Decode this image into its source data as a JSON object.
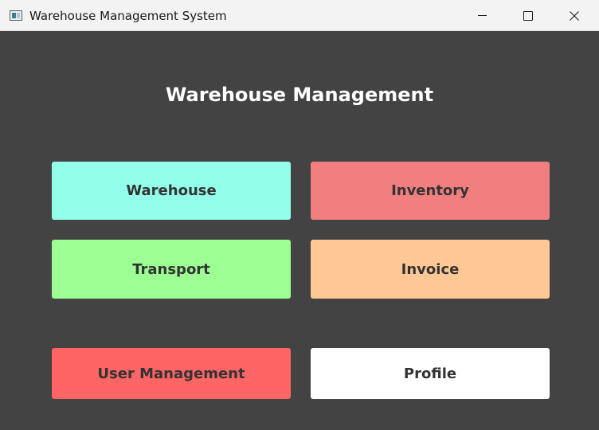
{
  "window": {
    "title": "Warehouse Management System",
    "icon": "app-window-icon",
    "controls": {
      "minimize_icon": "minimize-icon",
      "maximize_icon": "maximize-icon",
      "close_icon": "close-icon"
    }
  },
  "main": {
    "heading": "Warehouse Management",
    "buttons": [
      {
        "label": "Warehouse",
        "color": "#93ffea"
      },
      {
        "label": "Inventory",
        "color": "#f27f7f"
      },
      {
        "label": "Transport",
        "color": "#9bff93"
      },
      {
        "label": "Invoice",
        "color": "#ffc895"
      },
      {
        "label": "User Management",
        "color": "#fe6665"
      },
      {
        "label": "Profile",
        "color": "#ffffff"
      }
    ]
  },
  "colors": {
    "background": "#434343",
    "titlebar": "#f3f3f3",
    "heading_text": "#ffffff",
    "button_text": "#333333"
  }
}
